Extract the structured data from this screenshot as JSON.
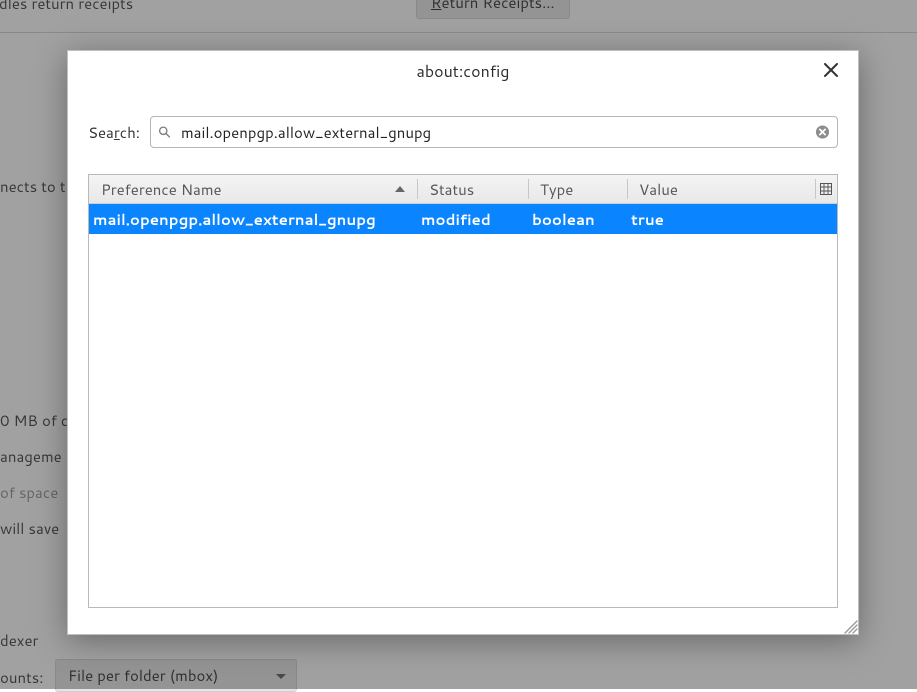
{
  "dialog": {
    "title": "about:config",
    "search_label_prefix": "Sea",
    "search_label_hotkey": "r",
    "search_label_suffix": "ch:",
    "search_value": "mail.openpgp.allow_external_gnupg",
    "columns": {
      "name": "Preference Name",
      "status": "Status",
      "type": "Type",
      "value": "Value"
    },
    "results": [
      {
        "name": "mail.openpgp.allow_external_gnupg",
        "status": "modified",
        "type": "boolean",
        "value": "true",
        "selected": true
      }
    ]
  },
  "background": {
    "row_receipts": "dles return receipts",
    "btn_return": "eturn Receipts…",
    "row_connects": "nects to t",
    "row_cache": "0 MB of c",
    "row_mgmt": "anageme",
    "row_space": "of space",
    "row_save": "will save",
    "row_indexer": "dexer",
    "row_accounts": "ounts:",
    "select_store": "File per folder (mbox)"
  }
}
